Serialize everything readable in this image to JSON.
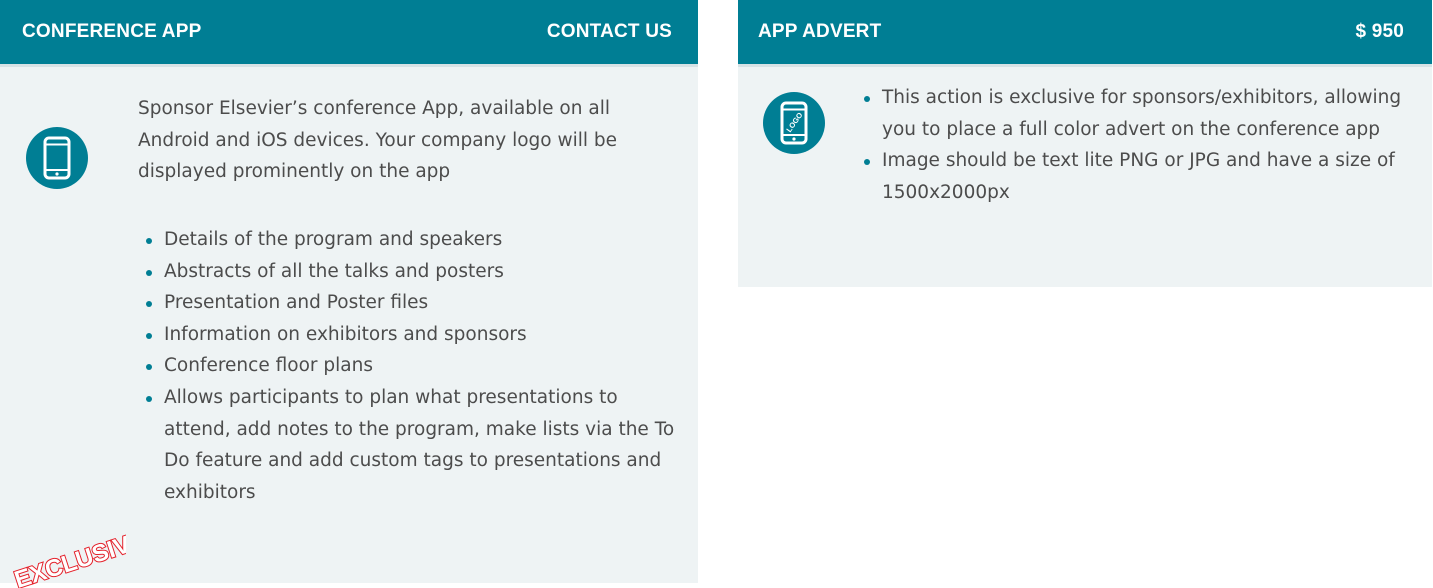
{
  "conference_app": {
    "title": "CONFERENCE APP",
    "contact": "CONTACT US",
    "icon": "smartphone-icon",
    "description": "Sponsor Elsevier’s conference App, available on all Android and iOS devices. Your company logo will be displayed prominently on the app",
    "features": [
      "Details of the program and speakers",
      "Abstracts of all the talks and posters",
      "Presentation and Poster files",
      "Information on exhibitors and sponsors",
      "Conference floor plans",
      "Allows participants to plan what presentations to attend, add notes to the program, make lists via the To Do feature and add custom tags to presentations and exhibitors"
    ],
    "badge": "EXCLUSIVE"
  },
  "app_advert": {
    "title": "APP ADVERT",
    "price": "$ 950",
    "icon": "smartphone-logo-icon",
    "logo_text": "LOGO",
    "points": [
      "This action is exclusive for sponsors/exhibitors, allowing you to place a full color advert  on the conference app",
      "Image should be text lite PNG or JPG and have a size of 1500x2000px"
    ]
  },
  "colors": {
    "header": "#007e94",
    "panel": "#eef3f4",
    "text": "#4c4c4c",
    "badge": "#e4202a"
  }
}
